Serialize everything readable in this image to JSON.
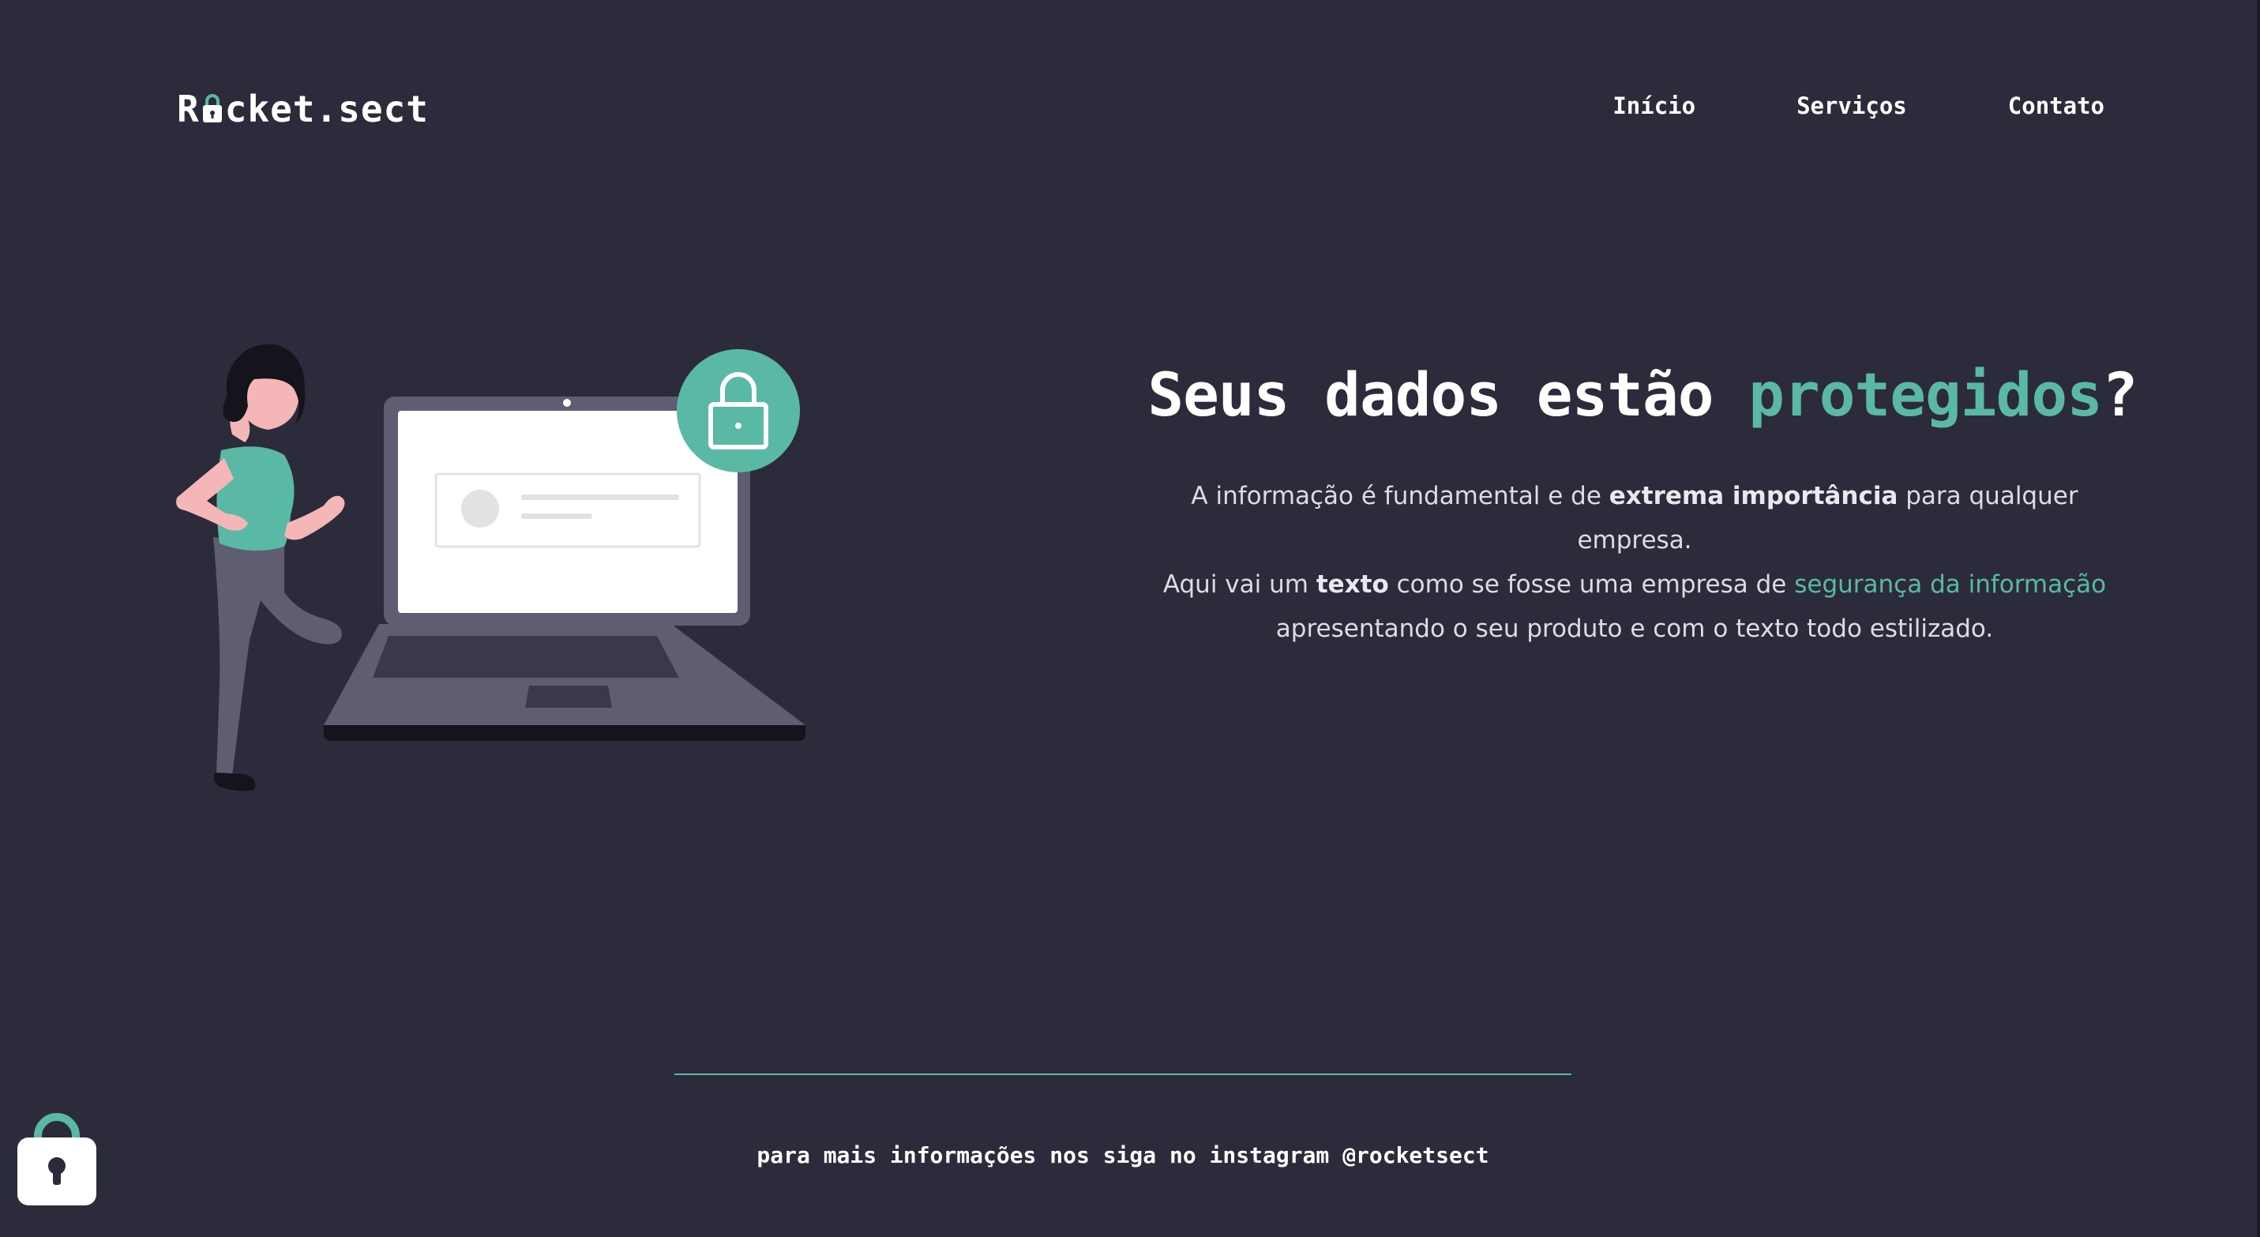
{
  "colors": {
    "background": "#2c2b3b",
    "accent": "#5ab9a5",
    "text": "#ffffff"
  },
  "header": {
    "logo_prefix": "R",
    "logo_suffix": "cket.sect",
    "nav": [
      {
        "label": "Início"
      },
      {
        "label": "Serviços"
      },
      {
        "label": "Contato"
      }
    ]
  },
  "hero": {
    "title_start": "Seus dados estão ",
    "title_accent": "protegidos",
    "title_end": "?",
    "p1_a": "A informação é fundamental e de ",
    "p1_bold": "extrema importância",
    "p1_b": " para qualquer empresa.",
    "p2_a": "Aqui vai um ",
    "p2_bold": "texto",
    "p2_b": " como se fosse uma empresa de ",
    "p2_link": "segurança da informação",
    "p2_c": " apresentando o seu produto e com o texto todo estilizado.",
    "illustration_icon": "person-with-laptop-lock-illustration"
  },
  "footer": {
    "text": "para mais informações nos siga no instagram @rocketsect",
    "badge_icon": "padlock-icon"
  }
}
